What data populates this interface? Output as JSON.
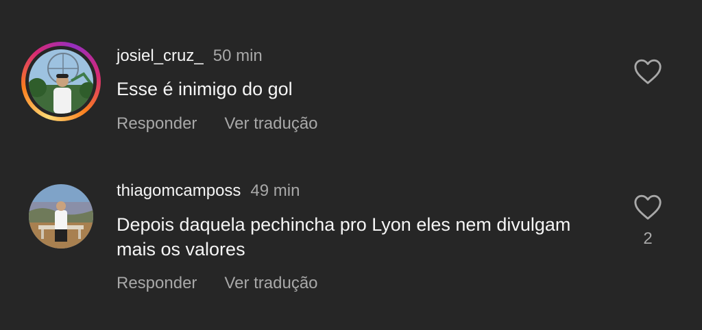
{
  "comments": [
    {
      "username": "josiel_cruz_",
      "time": "50 min",
      "text": "Esse é inimigo do gol",
      "reply_label": "Responder",
      "translate_label": "Ver tradução",
      "like_count": "",
      "icon": "heart-outline-icon"
    },
    {
      "username": "thiagomcamposs",
      "time": "49 min",
      "text": "Depois daquela pechincha pro Lyon eles nem divulgam mais os valores",
      "reply_label": "Responder",
      "translate_label": "Ver tradução",
      "like_count": "2",
      "icon": "heart-outline-icon"
    }
  ],
  "colors": {
    "background": "#262626",
    "primary_text": "#f5f5f5",
    "secondary_text": "#a8a8a8"
  }
}
